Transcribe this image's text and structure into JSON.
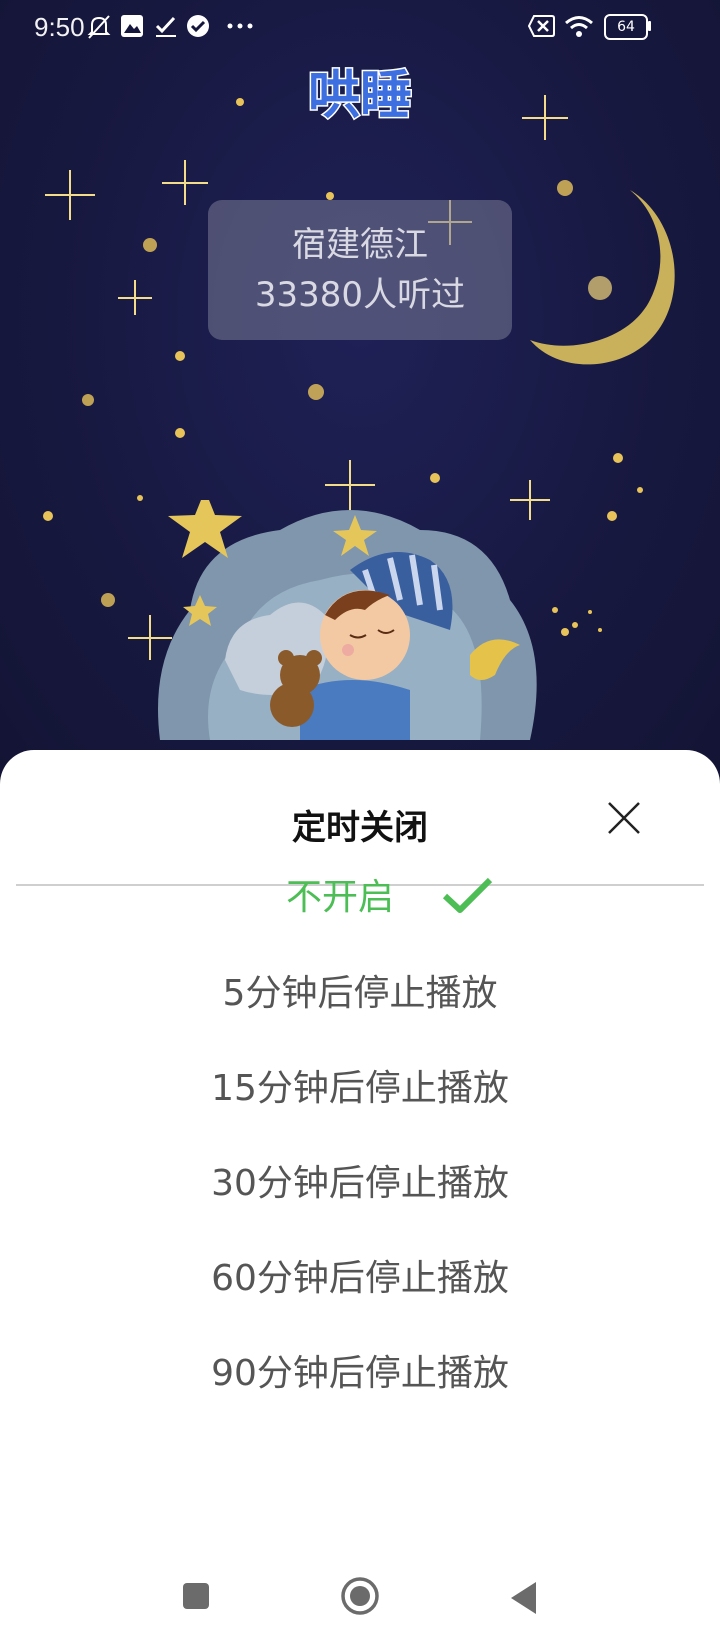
{
  "status_bar": {
    "time": "9:50",
    "icons": [
      "mute-bell-icon",
      "gallery-icon",
      "task-check-icon",
      "check-circle-icon",
      "more-dots-icon"
    ],
    "right_icons": [
      "sim-x-icon",
      "wifi-icon",
      "battery-icon"
    ],
    "battery": "64"
  },
  "header": {
    "title": "哄睡"
  },
  "info_card": {
    "name": "宿建德江",
    "listen_count": "33380人听过"
  },
  "sheet": {
    "title": "定时关闭",
    "options": [
      {
        "label": "不开启",
        "selected": true
      },
      {
        "label": "5分钟后停止播放",
        "selected": false
      },
      {
        "label": "15分钟后停止播放",
        "selected": false
      },
      {
        "label": "30分钟后停止播放",
        "selected": false
      },
      {
        "label": "60分钟后停止播放",
        "selected": false
      },
      {
        "label": "90分钟后停止播放",
        "selected": false
      }
    ]
  },
  "colors": {
    "accent_green": "#4cbe55",
    "background_night": "#17183f",
    "title_blue": "#3d6fe0"
  },
  "nav": {
    "buttons": [
      "recents-square-icon",
      "home-circle-icon",
      "back-triangle-icon"
    ]
  }
}
